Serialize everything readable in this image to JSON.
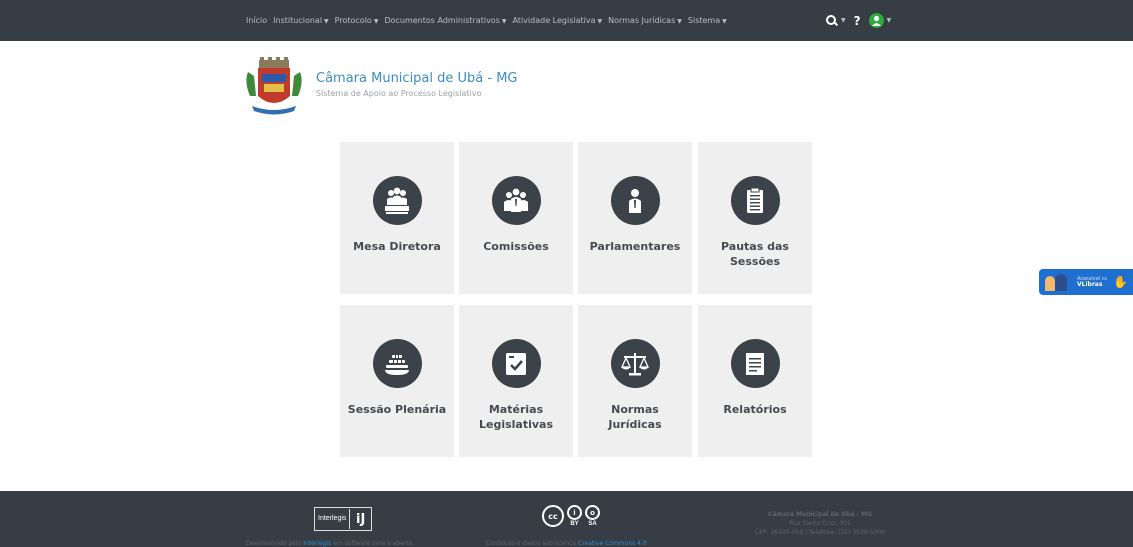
{
  "nav": {
    "items": [
      {
        "label": "Início",
        "caret": false
      },
      {
        "label": "Institucional",
        "caret": true
      },
      {
        "label": "Protocolo",
        "caret": true
      },
      {
        "label": "Documentos Administrativos",
        "caret": true
      },
      {
        "label": "Atividade Legislativa",
        "caret": true
      },
      {
        "label": "Normas Jurídicas",
        "caret": true
      },
      {
        "label": "Sistema",
        "caret": true
      }
    ],
    "help": "?"
  },
  "brand": {
    "title": "Câmara Municipal de Ubá - MG",
    "subtitle": "Sistema de Apoio ao Processo Legislativo"
  },
  "tiles": [
    {
      "label": "Mesa Diretora",
      "icon": "mesa-diretora-icon"
    },
    {
      "label": "Comissões",
      "icon": "comissoes-icon"
    },
    {
      "label": "Parlamentares",
      "icon": "parlamentares-icon"
    },
    {
      "label": "Pautas das\nSessões",
      "icon": "pautas-icon"
    },
    {
      "label": "Sessão Plenária",
      "icon": "sessao-plenaria-icon"
    },
    {
      "label": "Matérias\nLegislativas",
      "icon": "materias-icon"
    },
    {
      "label": "Normas\nJurídicas",
      "icon": "normas-icon"
    },
    {
      "label": "Relatórios",
      "icon": "relatorios-icon"
    }
  ],
  "vlibras": {
    "line1": "Acessível cc",
    "line2": "VLibras"
  },
  "footer": {
    "interlegis_word": "Interlegis",
    "interlegis_mark": "iJ",
    "cc_label": "cc",
    "cc_by": "BY",
    "cc_sa": "SA",
    "dev_prefix": "Desenvolvido pelo",
    "dev_link": "Interlegis",
    "dev_suffix": "em software livre e aberto.",
    "license_prefix": "Conteúdo e dados sob licença",
    "license_link": "Creative Commons 4.0",
    "org_name": "Câmara Municipal de Ubá - MG",
    "address": "Rua Santa Cruz, 301",
    "contact": "CEP: 36500-059 | Telefone: (32) 3539-5000"
  },
  "colors": {
    "navbar": "#363d45",
    "brand_blue": "#3a8dc6",
    "tile_bg": "#efefef",
    "icon_circle": "#3b4249",
    "user_green": "#2faa3c",
    "vlibras_blue": "#1f6fd1"
  }
}
